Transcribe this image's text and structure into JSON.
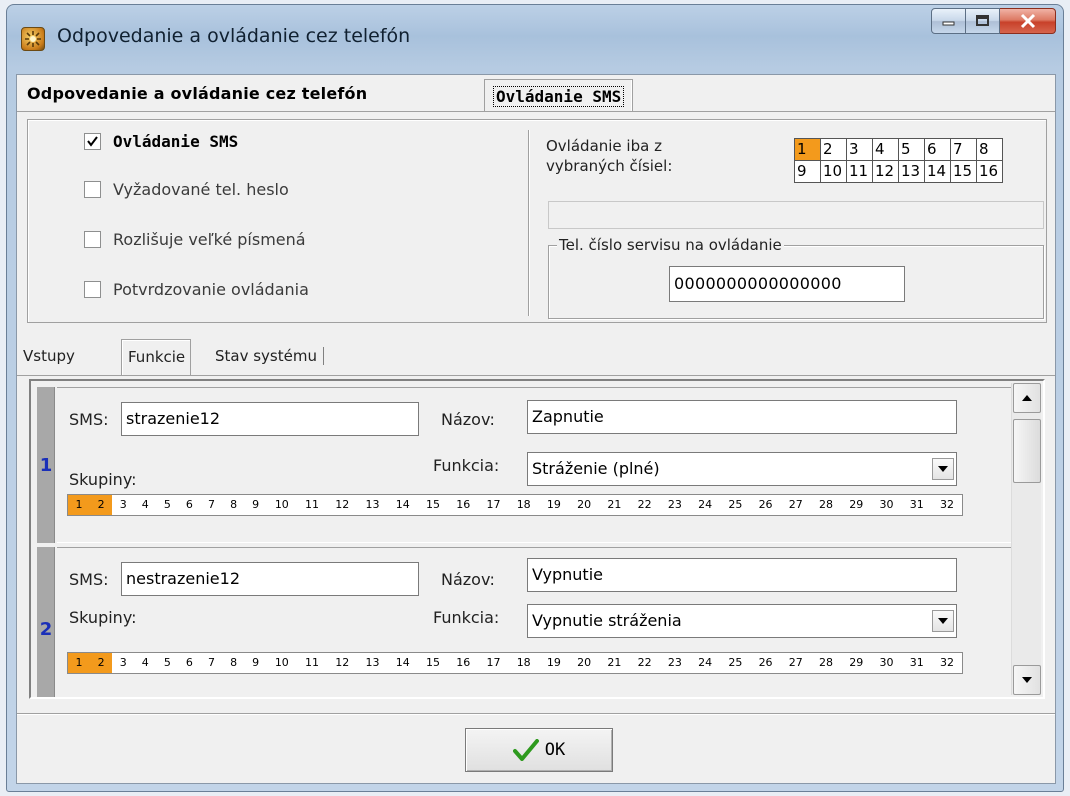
{
  "window": {
    "title": "Odpovedanie a ovládanie cez telefón"
  },
  "top_tabs": [
    {
      "label": "Odpovedanie a ovládanie cez telefón",
      "active": false
    },
    {
      "label": "Ovládanie SMS",
      "active": true
    }
  ],
  "options": {
    "sms_control": {
      "label": "Ovládanie SMS",
      "checked": true
    },
    "require_password": {
      "label": "Vyžadované tel. heslo",
      "checked": false
    },
    "case_sensitive": {
      "label": "Rozlišuje veľké písmená",
      "checked": false
    },
    "confirm_control": {
      "label": "Potvrdzovanie ovládania",
      "checked": false
    },
    "only_from_label": "Ovládanie iba z vybraných čísiel:",
    "phone_numbers": [
      "1",
      "2",
      "3",
      "4",
      "5",
      "6",
      "7",
      "8",
      "9",
      "10",
      "11",
      "12",
      "13",
      "14",
      "15",
      "16"
    ],
    "selected_numbers": [
      "1"
    ],
    "service_group_label": "Tel. číslo servisu na ovládanie",
    "service_number": "0000000000000000"
  },
  "sub_tabs": [
    {
      "label": "Vstupy",
      "active": false
    },
    {
      "label": "Funkcie",
      "active": true
    },
    {
      "label": "Stav systému",
      "active": false
    }
  ],
  "labels": {
    "sms": "SMS:",
    "name": "Názov:",
    "function": "Funkcia:",
    "groups": "Skupiny:"
  },
  "group_numbers": [
    "1",
    "2",
    "3",
    "4",
    "5",
    "6",
    "7",
    "8",
    "9",
    "10",
    "11",
    "12",
    "13",
    "14",
    "15",
    "16",
    "17",
    "18",
    "19",
    "20",
    "21",
    "22",
    "23",
    "24",
    "25",
    "26",
    "27",
    "28",
    "29",
    "30",
    "31",
    "32"
  ],
  "functions": [
    {
      "index": "1",
      "sms": "strazenie12",
      "name": "Zapnutie",
      "function": "Stráženie (plné)",
      "selected_groups": [
        "1",
        "2"
      ]
    },
    {
      "index": "2",
      "sms": "nestrazenie12",
      "name": "Vypnutie",
      "function": "Vypnutie stráženia",
      "selected_groups": [
        "1",
        "2"
      ]
    }
  ],
  "buttons": {
    "ok": "OK"
  },
  "colors": {
    "selected": "#f39a1c",
    "index_number": "#1a2fb8",
    "ok_check": "#2e9a1e"
  }
}
